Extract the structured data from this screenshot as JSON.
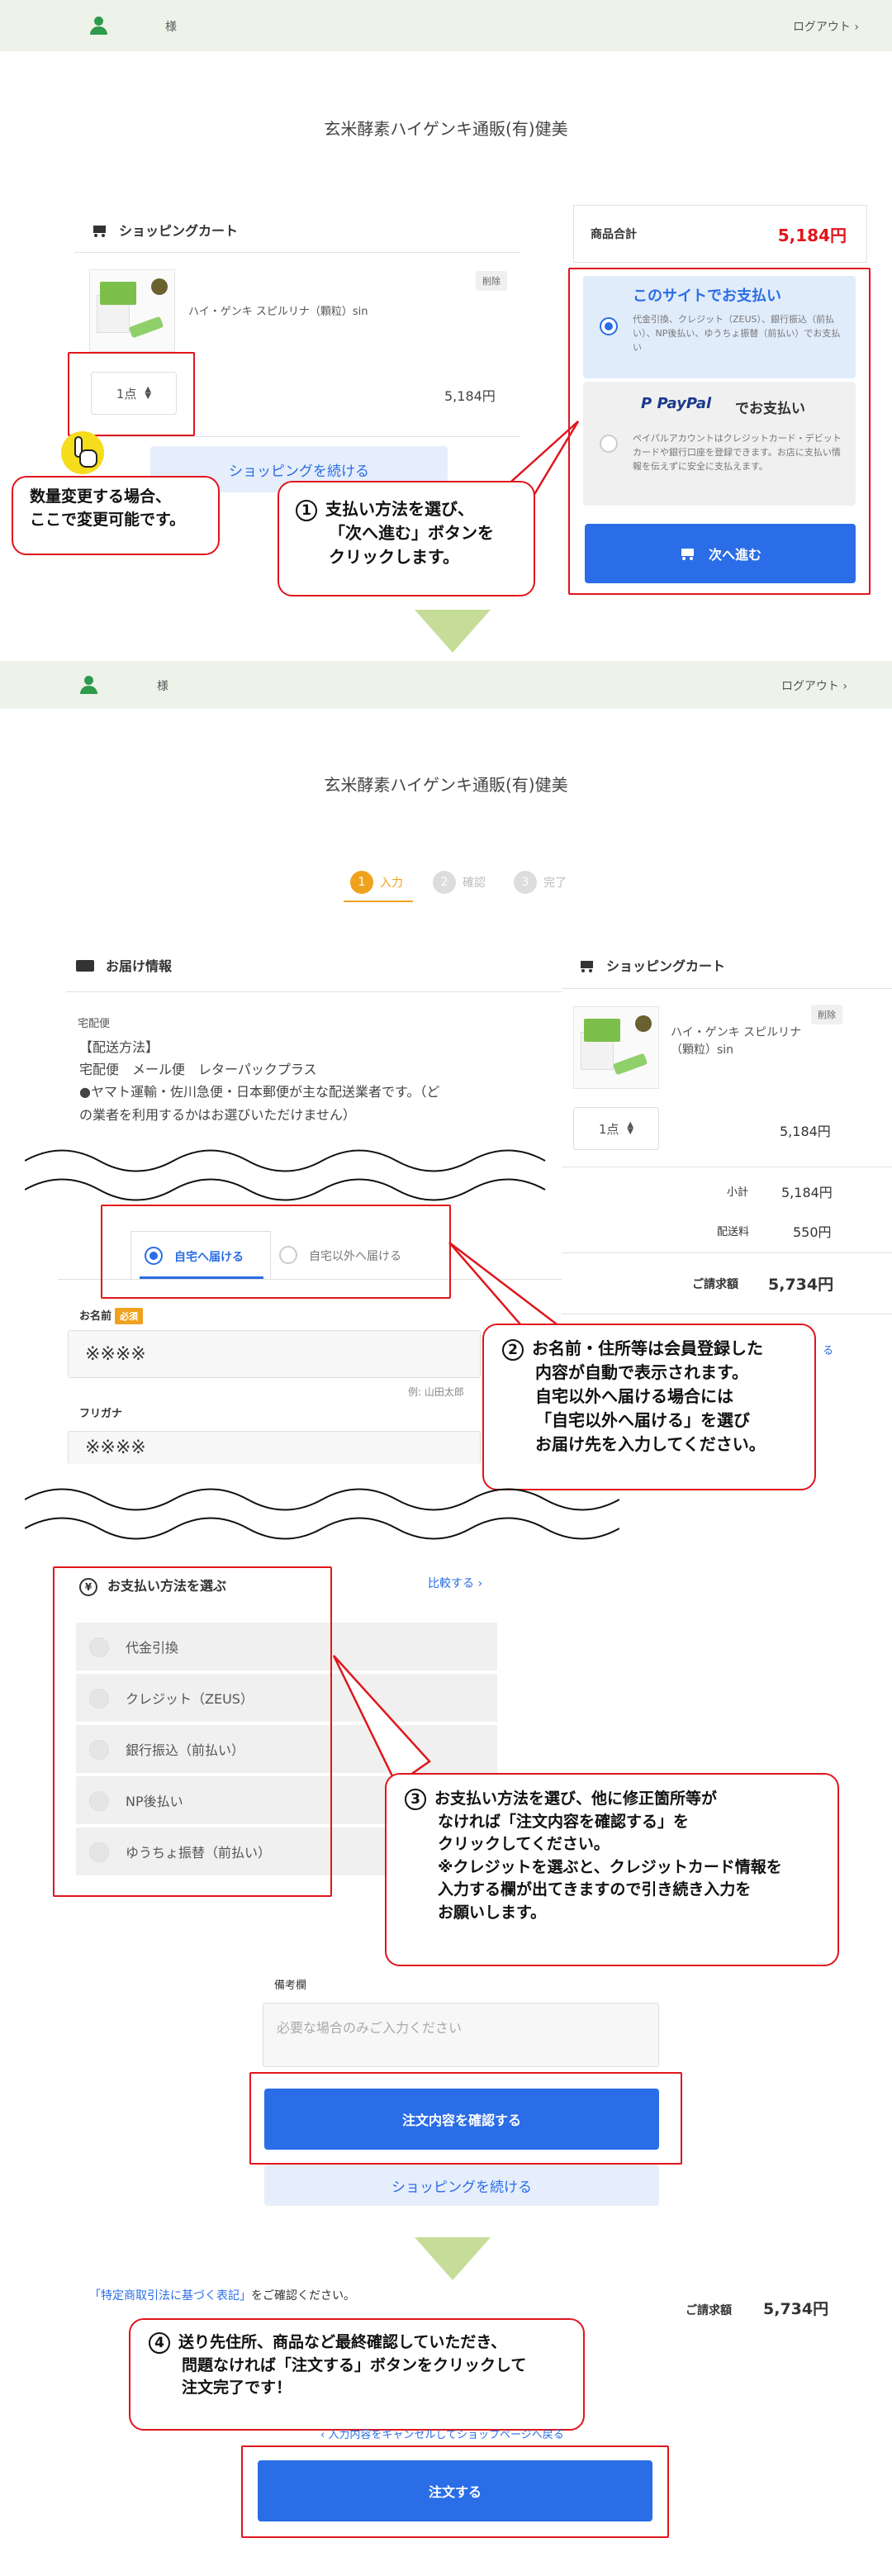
{
  "top": {
    "sama": "様",
    "logout": "ログアウト",
    "shop_name": "玄米酵素ハイゲンキ通販(有)健美"
  },
  "cart": {
    "title": "ショッピングカート",
    "delete": "削除",
    "product_name": "ハイ・ゲンキ スピルリナ（顆粒）sin",
    "qty": "1点",
    "price": "5,184円",
    "continue": "ショッピングを続ける"
  },
  "summary": {
    "subtotal_label": "商品合計",
    "subtotal": "5,184円",
    "site_pay_title": "このサイトでお支払い",
    "site_pay_desc": "代金引換、クレジット（ZEUS）、銀行振込（前払い）、NP後払い、ゆうちょ振替（前払い）でお支払い",
    "paypal_brand": "PayPal",
    "paypal_suffix": "でお支払い",
    "paypal_desc": "ペイパルアカウントはクレジットカード・デビットカードや銀行口座を登録できます。お店に支払い情報を伝えずに安全に支払えます。",
    "next": "次へ進む"
  },
  "callouts": {
    "qty_note_1": "数量変更する場合、",
    "qty_note_2": "ここで変更可能です。",
    "c1_line1": "支払い方法を選び、",
    "c1_line2": "「次へ進む」ボタンを",
    "c1_line3": "クリックします。",
    "c2_line1": "お名前・住所等は会員登録した",
    "c2_line2": "内容が自動で表示されます。",
    "c2_line3": "自宅以外へ届ける場合には",
    "c2_line4": "「自宅以外へ届ける」を選び",
    "c2_line5": "お届け先を入力してください。",
    "c3_line1": "お支払い方法を選び、他に修正箇所等が",
    "c3_line2": "なければ「注文内容を確認する」を",
    "c3_line3": "クリックしてください。",
    "c3_line4": "※クレジットを選ぶと、クレジットカード情報を",
    "c3_line5": "入力する欄が出てきますので引き続き入力を",
    "c3_line6": "お願いします。",
    "c4_line1": "送り先住所、商品など最終確認していただき、",
    "c4_line2": "問題なければ「注文する」ボタンをクリックして",
    "c4_line3": "注文完了です！",
    "n1": "1",
    "n2": "2",
    "n3": "3",
    "n4": "4"
  },
  "steps": {
    "s1": "入力",
    "s2": "確認",
    "s3": "完了",
    "n1": "1",
    "n2": "2",
    "n3": "3"
  },
  "delivery": {
    "title": "お届け情報",
    "kind": "宅配便",
    "method_label": "【配送方法】",
    "methods": "宅配便　メール便　レターパックプラス",
    "note1": "●ヤマト運輸・佐川急便・日本郵便が主な配送業者です。（ど",
    "note2": "の業者を利用するかはお選びいただけません）",
    "tab_home": "自宅へ届ける",
    "tab_other": "自宅以外へ届ける",
    "name_label": "お名前",
    "required": "必須",
    "name_value": "※※※※",
    "name_example": "例: 山田太郎",
    "kana_label": "フリガナ",
    "kana_value": "※※※※"
  },
  "cart2": {
    "title": "ショッピングカート",
    "delete": "削除",
    "product_name_1": "ハイ・ゲンキ スピルリナ",
    "product_name_2": "（顆粒）sin",
    "qty": "1点",
    "price": "5,184円",
    "subtotal_label": "小計",
    "subtotal": "5,184円",
    "shipping_label": "配送料",
    "shipping": "550円",
    "total_label": "ご請求額",
    "total": "5,734円",
    "edge_text": "る"
  },
  "payment": {
    "title": "お支払い方法を選ぶ",
    "compare": "比較する",
    "options": [
      "代金引換",
      "クレジット（ZEUS）",
      "銀行振込（前払い）",
      "NP後払い",
      "ゆうちょ振替（前払い）"
    ]
  },
  "remarks": {
    "label": "備考欄",
    "placeholder": "必要な場合のみご入力ください",
    "confirm": "注文内容を確認する",
    "continue": "ショッピングを続ける"
  },
  "final": {
    "law_link": "「特定商取引法に基づく表記」",
    "law_suffix": "をご確認ください。",
    "total_label": "ご請求額",
    "total": "5,734円",
    "cancel": "入力内容をキャンセルしてショップページへ戻る",
    "order": "注文する"
  },
  "colors": {
    "accent": "#2a6de6",
    "red": "#e0161d",
    "price_red": "#e0161d",
    "green_bar": "#eef3ea",
    "arrow": "#c6dd9a"
  }
}
